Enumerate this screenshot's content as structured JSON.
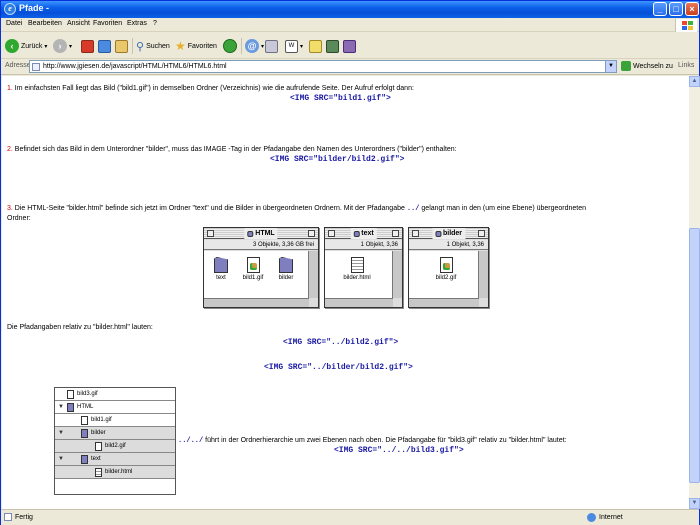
{
  "window": {
    "title": "Pfade -"
  },
  "menu": [
    "Datei",
    "Bearbeiten",
    "Ansicht",
    "Favoriten",
    "Extras",
    "?"
  ],
  "toolbar": {
    "back_label": "Zurück",
    "search_label": "Suchen",
    "favorites_label": "Favoriten"
  },
  "address": {
    "label": "Adresse",
    "url": "http://www.jgiesen.de/javascript/HTML/HTML6/HTML6.html",
    "go_label": "Wechseln zu",
    "links_label": "Links"
  },
  "content": {
    "p1_num": "1.",
    "p1_text": "Im einfachsten Fall liegt das Bild (\"bild1.gif\") in demselben Ordner (Verzeichnis) wie die aufrufende Seite. Der Aufruf erfolgt dann:",
    "code1": "<IMG SRC=\"bild1.gif\">",
    "p2_num": "2.",
    "p2_text": "Befindet sich das Bild in dem Unterordner \"bilder\", muss das IMAGE -Tag in der Pfadangabe den Namen des Unterordners (\"bilder\") enthalten:",
    "code2": "<IMG SRC=\"bilder/bild2.gif\">",
    "p3_num": "3.",
    "p3_text_a": "Die HTML-Seite \"bilder.html\" befinde sich jetzt im Ordner \"text\" und die Bilder in übergeordneten Ordnern. Mit der Pfadangabe",
    "p3_code": "../",
    "p3_text_b": "gelangt man in den (um eine Ebene) übergeordneten",
    "p3_text_c": "Ordner:",
    "p4_text": "Die Pfadangaben relativ zu \"bilder.html\" lauten:",
    "code3": "<IMG SRC=\"../bild2.gif\">",
    "code4": "<IMG SRC=\"../bilder/bild2.gif\">",
    "p5_code": "../../",
    "p5_text": "führt in der Ordnerhierarchie um zwei Ebenen nach oben. Die Pfadangabe für \"bild3.gif\" relativ zu \"bilder.html\" lautet:",
    "code5": "<IMG SRC=\"../../bild3.gif\">"
  },
  "finder": [
    {
      "title": "HTML",
      "info": "3 Objekte, 3,36 GB frei",
      "items": [
        "text",
        "bild1.gif",
        "bilder"
      ]
    },
    {
      "title": "text",
      "info": "1 Objekt, 3,36",
      "items": [
        "bilder.html"
      ]
    },
    {
      "title": "bilder",
      "info": "1 Objekt, 3,36",
      "items": [
        "bild2.gif"
      ]
    }
  ],
  "tree": [
    "bild3.gif",
    "HTML",
    "bild1.gif",
    "bilder",
    "bild2.gif",
    "text",
    "bilder.html"
  ],
  "status": {
    "left": "Fertig",
    "zone": "Internet"
  }
}
